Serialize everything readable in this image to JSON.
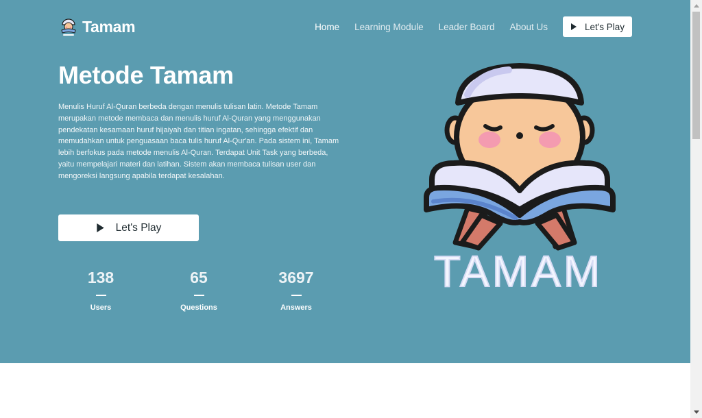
{
  "brand": {
    "name": "Tamam",
    "logo_icon": "tamam-logo-icon"
  },
  "nav": {
    "links": [
      {
        "label": "Home",
        "active": true
      },
      {
        "label": "Learning Module",
        "active": false
      },
      {
        "label": "Leader Board",
        "active": false
      },
      {
        "label": "About Us",
        "active": false
      }
    ],
    "cta_label": "Let's Play"
  },
  "hero": {
    "title": "Metode Tamam",
    "description": "Menulis Huruf Al-Quran berbeda dengan menulis tulisan latin. Metode Tamam merupakan metode membaca dan menulis huruf Al-Quran yang menggunakan pendekatan kesamaan huruf hijaiyah dan titian ingatan, sehingga efektif dan memudahkan untuk penguasaan baca tulis huruf Al-Qur'an. Pada sistem ini, Tamam lebih berfokus pada metode menulis Al-Quran. Terdapat Unit Task yang berbeda, yaitu mempelajari materi dan latihan. Sistem akan membaca tulisan user dan mengoreksi langsung apabila terdapat kesalahan.",
    "cta_label": "Let's Play",
    "illustration_text": "TAMAM"
  },
  "stats": [
    {
      "value": "138",
      "label": "Users"
    },
    {
      "value": "65",
      "label": "Questions"
    },
    {
      "value": "3697",
      "label": "Answers"
    }
  ],
  "colors": {
    "hero_bg": "#5b9cb0",
    "button_bg": "#ffffff",
    "button_text": "#1f2b30"
  }
}
